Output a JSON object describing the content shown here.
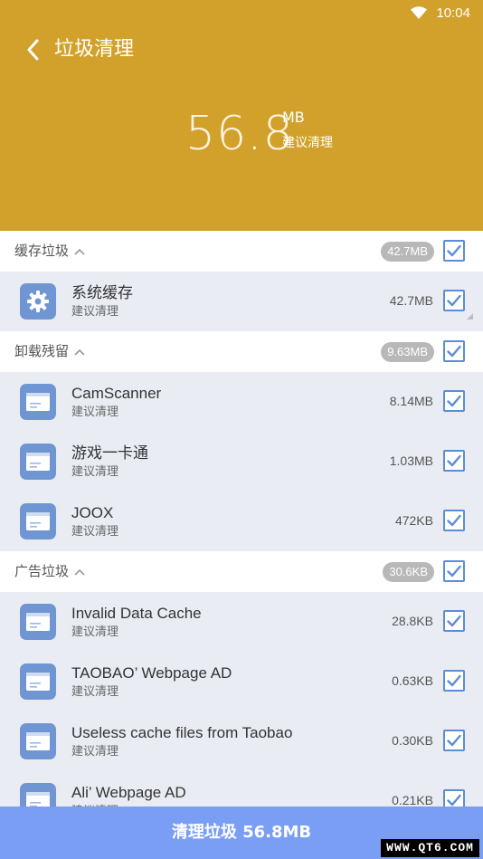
{
  "status_bar": {
    "time": "10:04"
  },
  "header": {
    "title": "垃圾清理",
    "total_value": "56.8",
    "total_unit": "MB",
    "total_hint": "建议清理",
    "bg_color": "#d2a12c"
  },
  "sections": [
    {
      "title": "缓存垃圾",
      "size": "42.7MB",
      "checked": true,
      "items": [
        {
          "icon": "gear-icon",
          "name": "系统缓存",
          "sub": "建议清理",
          "size": "42.7MB",
          "checked": true
        }
      ]
    },
    {
      "title": "卸载残留",
      "size": "9.63MB",
      "checked": true,
      "items": [
        {
          "icon": "folder-icon",
          "name": "CamScanner",
          "sub": "建议清理",
          "size": "8.14MB",
          "checked": true
        },
        {
          "icon": "folder-icon",
          "name": "游戏一卡通",
          "sub": "建议清理",
          "size": "1.03MB",
          "checked": true
        },
        {
          "icon": "folder-icon",
          "name": "JOOX",
          "sub": "建议清理",
          "size": "472KB",
          "checked": true
        }
      ]
    },
    {
      "title": "广告垃圾",
      "size": "30.6KB",
      "checked": true,
      "items": [
        {
          "icon": "folder-icon",
          "name": "Invalid Data Cache",
          "sub": "建议清理",
          "size": "28.8KB",
          "checked": true
        },
        {
          "icon": "folder-icon",
          "name": "TAOBAO’ Webpage AD",
          "sub": "建议清理",
          "size": "0.63KB",
          "checked": true
        },
        {
          "icon": "folder-icon",
          "name": "Useless cache files from Taobao",
          "sub": "建议清理",
          "size": "0.30KB",
          "checked": true
        },
        {
          "icon": "folder-icon",
          "name": "Ali’ Webpage AD",
          "sub": "建议清理",
          "size": "0.21KB",
          "checked": true
        }
      ]
    }
  ],
  "bottom_button": {
    "label": "清理垃圾 56.8MB",
    "bg_color": "#7b9ef5"
  },
  "watermark": "WWW.QT6.COM",
  "colors": {
    "accent": "#5b8dd6",
    "icon_bg": "#6f96d2"
  }
}
